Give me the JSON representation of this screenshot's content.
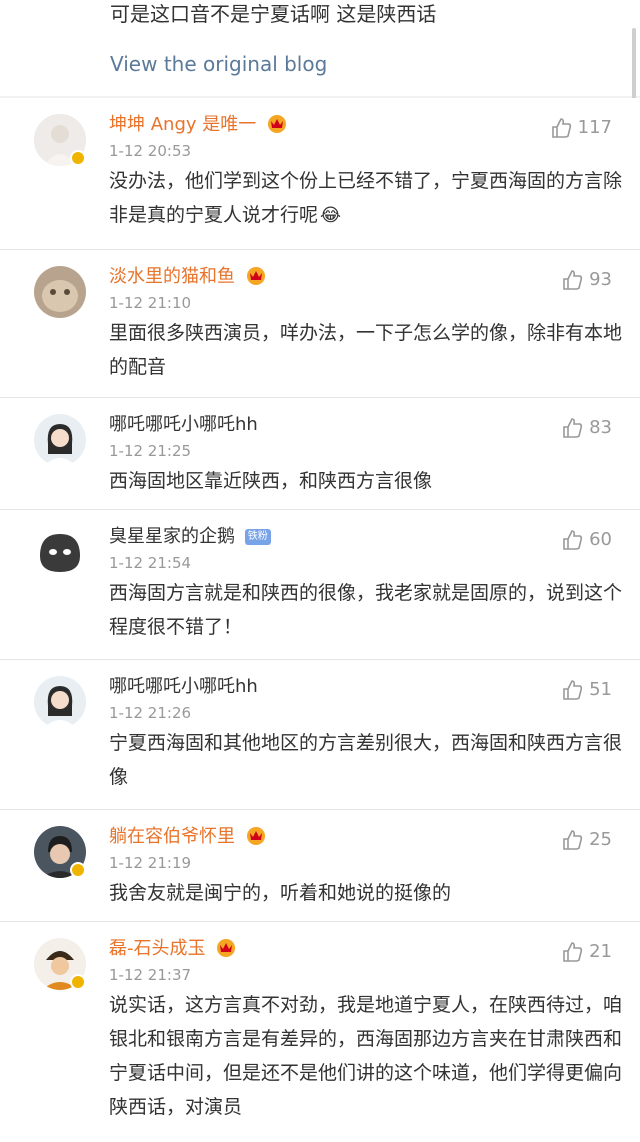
{
  "post": {
    "text": "可是这口音不是宁夏话啊 这是陕西话",
    "view_original": "View the original blog"
  },
  "comments": [
    {
      "name": "坤坤 Angy 是唯一",
      "time": "1-12 20:53",
      "likes": "117",
      "content": "没办法，他们学到这个份上已经不错了，宁夏西海固的方言除非是真的宁夏人说才行呢"
    },
    {
      "name": "淡水里的猫和鱼",
      "time": "1-12 21:10",
      "likes": "93",
      "content": "里面很多陕西演员，咩办法，一下子怎么学的像，除非有本地的配音"
    },
    {
      "name": "哪吒哪吒小哪吒hh",
      "time": "1-12 21:25",
      "likes": "83",
      "content": "西海固地区靠近陕西，和陕西方言很像"
    },
    {
      "name": "臭星星家的企鹅",
      "badge": "铁粉",
      "time": "1-12 21:54",
      "likes": "60",
      "content": "西海固方言就是和陕西的很像，我老家就是固原的，说到这个程度很不错了！"
    },
    {
      "name": "哪吒哪吒小哪吒hh",
      "time": "1-12 21:26",
      "likes": "51",
      "content": "宁夏西海固和其他地区的方言差别很大，西海固和陕西方言很像"
    },
    {
      "name": "躺在容伯爷怀里",
      "time": "1-12 21:19",
      "likes": "25",
      "content": "我舍友就是闽宁的，听着和她说的挺像的"
    },
    {
      "name": "磊-石头成玉",
      "time": "1-12 21:37",
      "likes": "21",
      "content": "说实话，这方言真不对劲，我是地道宁夏人，在陕西待过，咱银北和银南方言是有差异的，西海固那边方言夹在甘肃陕西和宁夏话中间，但是还不是他们讲的这个味道，他们学得更偏向陕西话，对演员"
    }
  ],
  "colors": {
    "accent_name": "#e8742b",
    "link": "#5b7a9a",
    "verified": "#f0b400"
  },
  "icons": [
    "thumbs-up-icon",
    "crown-member-icon",
    "verified-badge-icon",
    "laugh-cry-emoji-icon"
  ]
}
